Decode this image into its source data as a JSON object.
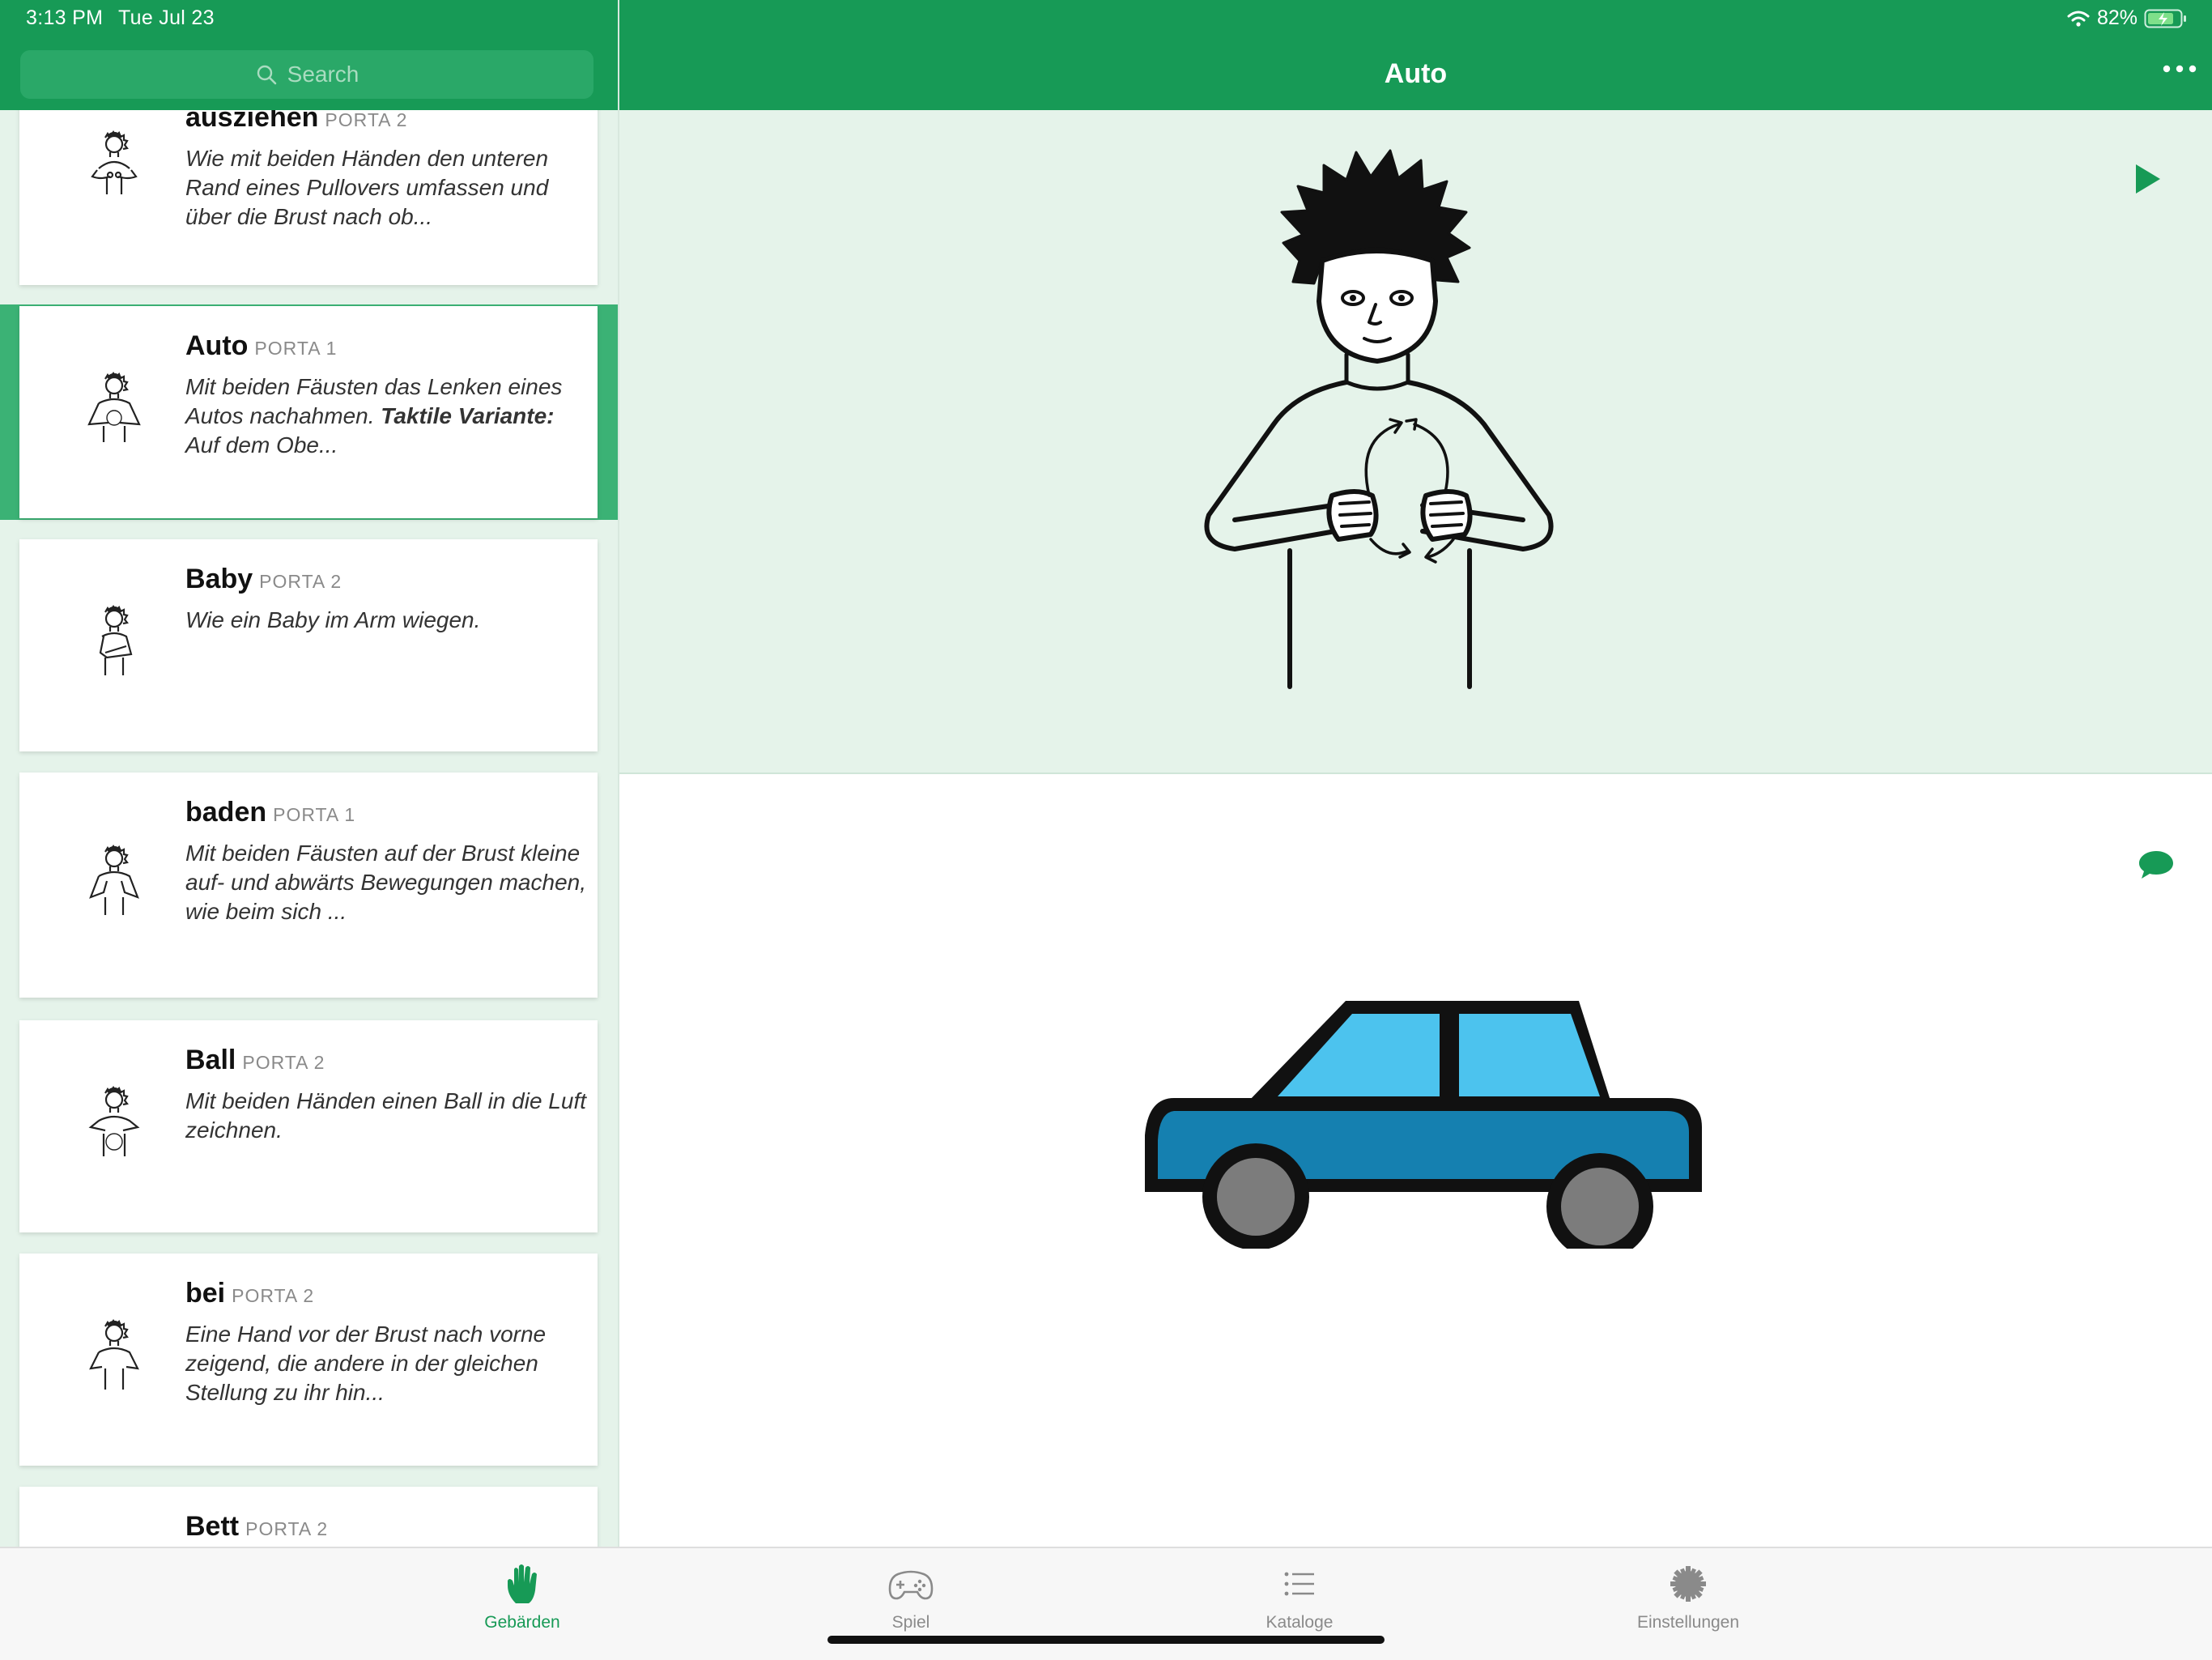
{
  "status_bar": {
    "time": "3:13 PM",
    "date": "Tue Jul 23",
    "battery": "82%"
  },
  "search": {
    "placeholder": "Search"
  },
  "detail": {
    "title": "Auto"
  },
  "entries": [
    {
      "word": "ausziehen",
      "category": "PORTA 2",
      "description": "Wie mit beiden Händen den unteren Rand eines Pullovers umfassen und über die Brust nach ob..."
    },
    {
      "word": "Auto",
      "category": "PORTA 1",
      "description_pre": "Mit beiden Fäusten das Lenken eines Autos nachahmen. ",
      "description_bold": "Taktile Variante:",
      "description_post": " Auf dem Obe...",
      "selected": true
    },
    {
      "word": "Baby",
      "category": "PORTA 2",
      "description": "Wie ein Baby im Arm wiegen."
    },
    {
      "word": "baden",
      "category": "PORTA 1",
      "description": "Mit beiden Fäusten auf der Brust kleine auf- und abwärts Bewegungen machen, wie beim sich ..."
    },
    {
      "word": "Ball",
      "category": "PORTA 2",
      "description": "Mit beiden Händen einen Ball in die Luft zeichnen."
    },
    {
      "word": "bei",
      "category": "PORTA 2",
      "description": "Eine Hand vor der Brust nach vorne zeigend, die andere in der gleichen Stellung zu ihr hin..."
    },
    {
      "word": "Bett",
      "category": "PORTA 2",
      "description": ""
    }
  ],
  "tabs": [
    {
      "label": "Gebärden",
      "icon": "hand-icon",
      "active": true
    },
    {
      "label": "Spiel",
      "icon": "gamepad-icon",
      "active": false
    },
    {
      "label": "Kataloge",
      "icon": "list-icon",
      "active": false
    },
    {
      "label": "Einstellungen",
      "icon": "gear-icon",
      "active": false
    }
  ],
  "colors": {
    "brand_green": "#179a56",
    "selected_green": "#3bb275",
    "pane_tint": "#e5f3ea",
    "car_body": "#1580b0",
    "car_window": "#4cc3ee"
  }
}
